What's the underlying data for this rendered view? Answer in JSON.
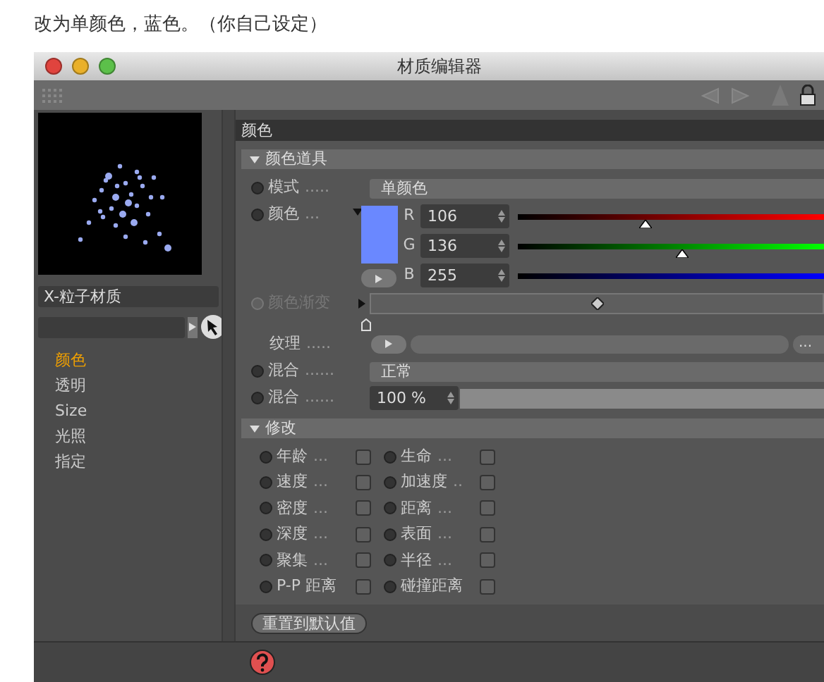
{
  "caption": "改为单颜色，蓝色。（你自己设定）",
  "window": {
    "title": "材质编辑器"
  },
  "material": {
    "name": "X-粒子材质"
  },
  "channels": [
    {
      "label": "颜色",
      "selected": true
    },
    {
      "label": "透明",
      "selected": false
    },
    {
      "label": "Size",
      "selected": false
    },
    {
      "label": "光照",
      "selected": false
    },
    {
      "label": "指定",
      "selected": false
    }
  ],
  "panel": {
    "header": "颜色",
    "section": "颜色道具",
    "mode": {
      "label": "模式",
      "dots": ".....",
      "animated": false,
      "value": "单颜色"
    },
    "color": {
      "label": "颜色",
      "dots": "...",
      "animated": false,
      "components": [
        {
          "name": "R",
          "value": "106",
          "level": 0.416
        },
        {
          "name": "G",
          "value": "136",
          "level": 0.533
        },
        {
          "name": "B",
          "value": "255"
        }
      ]
    },
    "gradient": {
      "label": "颜色渐变",
      "animated": false,
      "disabled": true
    },
    "texture": {
      "label": "纹理",
      "dots": ".....",
      "more": "..."
    },
    "blend_mode": {
      "label": "混合",
      "dots": "......",
      "animated": false,
      "value": "正常"
    },
    "blend_strength": {
      "label": "混合",
      "dots": "......",
      "animated": false,
      "value": "100 %"
    }
  },
  "modify": {
    "title": "修改",
    "items": [
      {
        "label": "年龄",
        "dots": "...",
        "animated": false,
        "checked": false
      },
      {
        "label": "生命",
        "dots": "...",
        "animated": false,
        "checked": false
      },
      {
        "label": "速度",
        "dots": "...",
        "animated": false,
        "checked": false
      },
      {
        "label": "加速度",
        "dots": "..",
        "animated": false,
        "checked": false
      },
      {
        "label": "密度",
        "dots": "...",
        "animated": false,
        "checked": false
      },
      {
        "label": "距离",
        "dots": "...",
        "animated": false,
        "checked": false
      },
      {
        "label": "深度",
        "dots": "...",
        "animated": false,
        "checked": false
      },
      {
        "label": "表面",
        "dots": "...",
        "animated": false,
        "checked": false
      },
      {
        "label": "聚集",
        "dots": "...",
        "animated": false,
        "checked": false
      },
      {
        "label": "半径",
        "dots": "...",
        "animated": false,
        "checked": false
      },
      {
        "label": "P-P 距离",
        "animated": false,
        "checked": false
      },
      {
        "label": "碰撞距离",
        "animated": false,
        "checked": false
      }
    ]
  },
  "reset_button": "重置到默认值"
}
